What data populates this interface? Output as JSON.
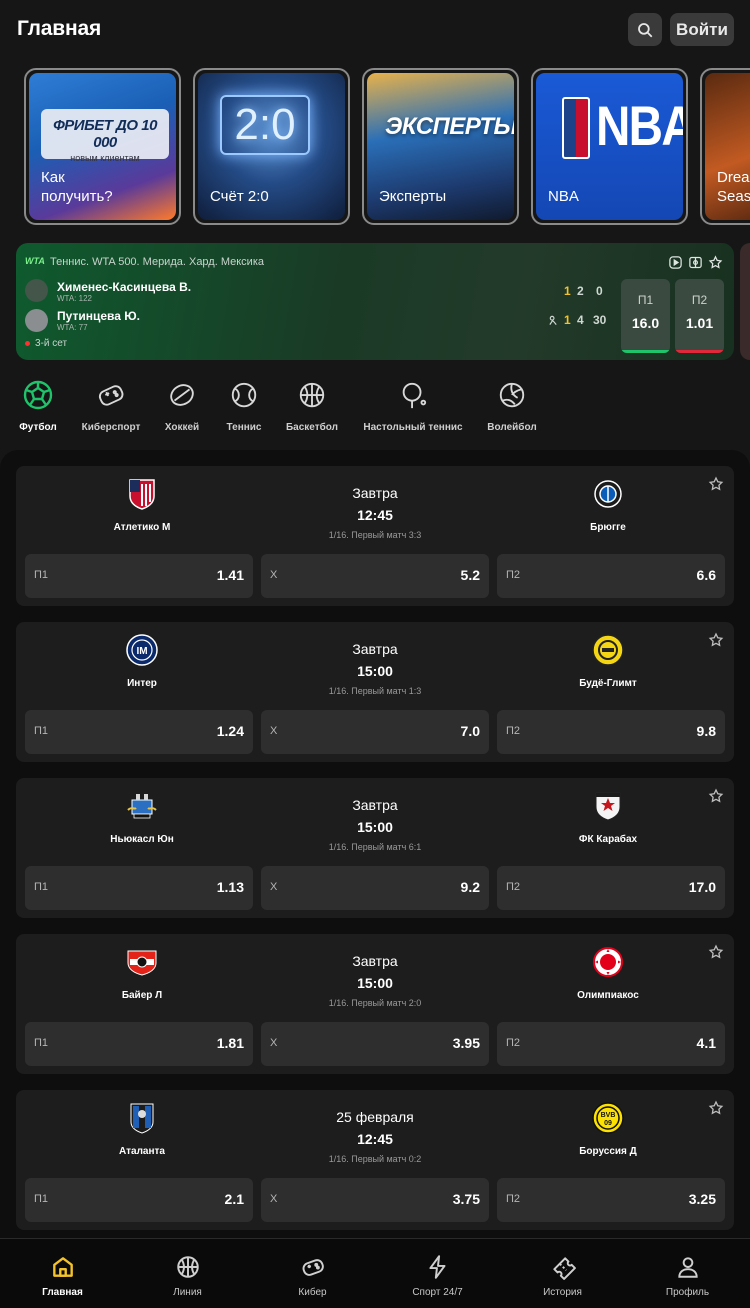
{
  "header": {
    "title": "Главная",
    "login_label": "Войти"
  },
  "stories": [
    {
      "label": "Как получить?",
      "promo_title": "ФРИБЕТ ДО 10 000",
      "promo_sub": "новым клиентам"
    },
    {
      "label": "Счёт 2:0",
      "art_text": "2:0"
    },
    {
      "label": "Эксперты",
      "art_text": "ЭКСПЕРТЫ"
    },
    {
      "label": "NBA",
      "art_text": "NBA"
    },
    {
      "label": "Drea Seas"
    }
  ],
  "live_match": {
    "league_logo": "WTA",
    "tournament": "Теннис. WTA 500. Мерида. Хард. Мексика",
    "player1": {
      "name": "Хименес-Касинцева В.",
      "rank": "WTA: 122",
      "set": "1",
      "games": "2",
      "points": "0"
    },
    "player2": {
      "name": "Путинцева Ю.",
      "rank": "WTA: 77",
      "set": "1",
      "games": "4",
      "points": "30"
    },
    "status": "3-й сет",
    "odds": [
      {
        "label": "П1",
        "value": "16.0",
        "bar_color": "#1fc36a"
      },
      {
        "label": "П2",
        "value": "1.01",
        "bar_color": "#e0283a"
      }
    ]
  },
  "sports": [
    {
      "label": "Футбол",
      "icon": "football-icon"
    },
    {
      "label": "Киберспорт",
      "icon": "gamepad-icon"
    },
    {
      "label": "Хоккей",
      "icon": "hockey-puck-icon"
    },
    {
      "label": "Теннис",
      "icon": "tennis-ball-icon"
    },
    {
      "label": "Баскетбол",
      "icon": "basketball-icon"
    },
    {
      "label": "Настольный теннис",
      "icon": "ping-pong-icon"
    },
    {
      "label": "Волейбол",
      "icon": "volleyball-icon"
    }
  ],
  "matches": [
    {
      "home": "Атлетико М",
      "away": "Брюгге",
      "when": "Завтра",
      "time": "12:45",
      "stage": "1/16. Первый матч 3:3",
      "odds": [
        {
          "k": "П1",
          "v": "1.41"
        },
        {
          "k": "Х",
          "v": "5.2"
        },
        {
          "k": "П2",
          "v": "6.6"
        }
      ]
    },
    {
      "home": "Интер",
      "away": "Будё-Глимт",
      "when": "Завтра",
      "time": "15:00",
      "stage": "1/16. Первый матч 1:3",
      "odds": [
        {
          "k": "П1",
          "v": "1.24"
        },
        {
          "k": "Х",
          "v": "7.0"
        },
        {
          "k": "П2",
          "v": "9.8"
        }
      ]
    },
    {
      "home": "Ньюкасл Юн",
      "away": "ФК Карабах",
      "when": "Завтра",
      "time": "15:00",
      "stage": "1/16. Первый матч 6:1",
      "odds": [
        {
          "k": "П1",
          "v": "1.13"
        },
        {
          "k": "Х",
          "v": "9.2"
        },
        {
          "k": "П2",
          "v": "17.0"
        }
      ]
    },
    {
      "home": "Байер Л",
      "away": "Олимпиакос",
      "when": "Завтра",
      "time": "15:00",
      "stage": "1/16. Первый матч 2:0",
      "odds": [
        {
          "k": "П1",
          "v": "1.81"
        },
        {
          "k": "Х",
          "v": "3.95"
        },
        {
          "k": "П2",
          "v": "4.1"
        }
      ]
    },
    {
      "home": "Аталанта",
      "away": "Боруссия Д",
      "when": "25 февраля",
      "time": "12:45",
      "stage": "1/16. Первый матч 0:2",
      "odds": [
        {
          "k": "П1",
          "v": "2.1"
        },
        {
          "k": "Х",
          "v": "3.75"
        },
        {
          "k": "П2",
          "v": "3.25"
        }
      ]
    }
  ],
  "nav": [
    {
      "label": "Главная",
      "icon": "home-icon"
    },
    {
      "label": "Линия",
      "icon": "ball-icon"
    },
    {
      "label": "Кибер",
      "icon": "gamepad-icon"
    },
    {
      "label": "Спорт 24/7",
      "icon": "lightning-icon"
    },
    {
      "label": "История",
      "icon": "ticket-icon"
    },
    {
      "label": "Профиль",
      "icon": "user-icon"
    }
  ],
  "colors": {
    "accent": "#f4c22a",
    "active_green": "#1fc36a",
    "loss_red": "#e0283a"
  }
}
